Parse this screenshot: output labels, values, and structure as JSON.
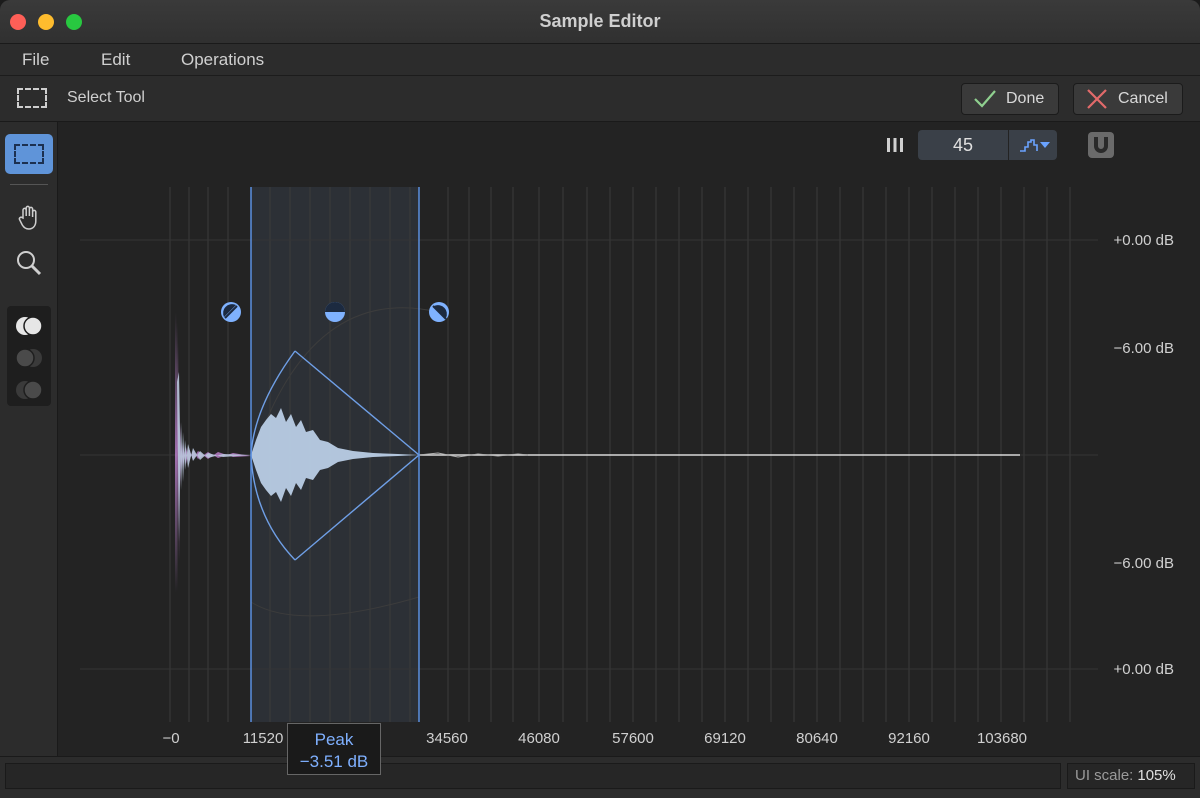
{
  "window": {
    "title": "Sample Editor"
  },
  "menu": [
    "File",
    "Edit",
    "Operations"
  ],
  "toolbar": {
    "tool_label": "Select Tool",
    "done_label": "Done",
    "cancel_label": "Cancel"
  },
  "zoom": {
    "value": "45"
  },
  "axis": {
    "db_labels": [
      "+0.00 dB",
      "−6.00 dB",
      "−6.00 dB",
      "+0.00 dB"
    ],
    "x_labels": [
      "−0",
      "11520",
      "34560",
      "46080",
      "57600",
      "69120",
      "80640",
      "92160",
      "103680"
    ]
  },
  "peak": {
    "label": "Peak",
    "value": "−3.51 dB"
  },
  "status": {
    "ui_scale_label": "UI scale:",
    "ui_scale_value": "105%"
  },
  "colors": {
    "accent": "#5f94d9",
    "waveform": "#b9c6dc",
    "waveform_alt": "#b07ac0",
    "selection_line": "#5b8fe0"
  }
}
